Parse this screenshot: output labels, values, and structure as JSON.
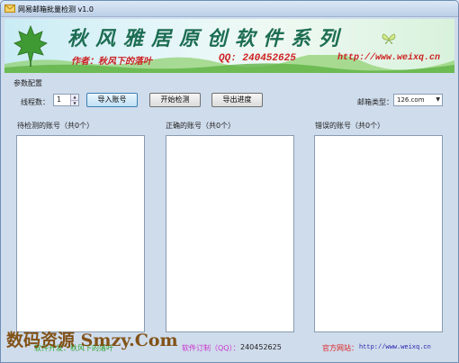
{
  "window": {
    "title": "网易邮箱批量检测 v1.0"
  },
  "banner": {
    "title": "秋风雅居原创软件系列",
    "author": "作者：秋风下的落叶",
    "qq": "QQ: 240452625",
    "url": "http://www.weixq.cn"
  },
  "settings": {
    "group_label": "参数配置",
    "thread_label": "线程数：",
    "thread_value": "1",
    "import_label": "导入账号",
    "start_label": "开始检测",
    "export_label": "导出进度",
    "mailtype_label": "邮箱类型：",
    "mailtype_value": "126.com"
  },
  "lists": [
    {
      "label": "待检测的账号（共0个）"
    },
    {
      "label": "正确的账号（共0个）"
    },
    {
      "label": "错误的账号（共0个）"
    }
  ],
  "footer": {
    "developer": "软件开发：秋风下的落叶",
    "qq_label": "软件订制（QQ）：",
    "qq_number": "240452625",
    "site_label": "官方网站：",
    "site_url": "http://www.weixq.cn"
  },
  "watermark": "数码资源 Smzy.Com",
  "colors": {
    "banner_title": "#1d6d52",
    "banner_accent": "#cc2222"
  }
}
